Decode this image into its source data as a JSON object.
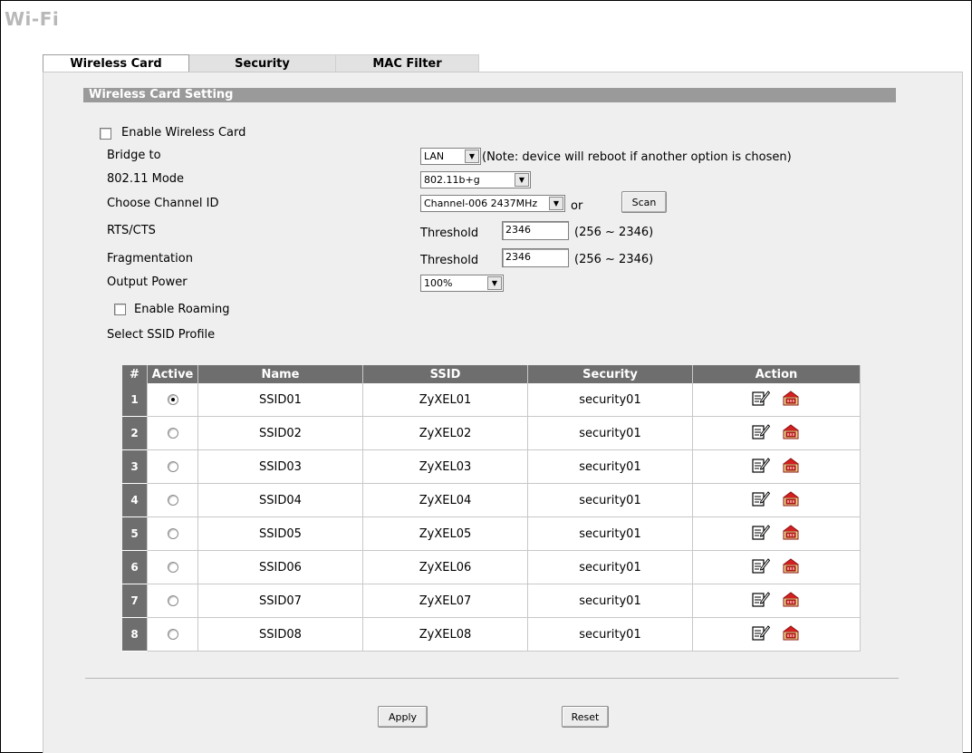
{
  "page": {
    "title": "Wi-Fi"
  },
  "tabs": [
    {
      "label": "Wireless Card",
      "active": true
    },
    {
      "label": "Security",
      "active": false
    },
    {
      "label": "MAC Filter",
      "active": false
    }
  ],
  "section": {
    "title": "Wireless Card Setting"
  },
  "form": {
    "enable_wireless_card": {
      "label": "Enable Wireless Card",
      "checked": false
    },
    "bridge_to": {
      "label": "Bridge to",
      "value": "LAN",
      "note": "(Note: device will reboot if another option is chosen)"
    },
    "mode": {
      "label": "802.11 Mode",
      "value": "802.11b+g"
    },
    "channel": {
      "label": "Choose Channel ID",
      "value": "Channel-006 2437MHz",
      "or": "or",
      "scan_label": "Scan"
    },
    "rts": {
      "label": "RTS/CTS",
      "threshold_label": "Threshold",
      "value": "2346",
      "range": "(256 ~ 2346)"
    },
    "frag": {
      "label": "Fragmentation",
      "threshold_label": "Threshold",
      "value": "2346",
      "range": "(256 ~ 2346)"
    },
    "power": {
      "label": "Output Power",
      "value": "100%"
    },
    "roaming": {
      "label": "Enable Roaming",
      "checked": false
    },
    "ssid_profile_label": "Select SSID Profile"
  },
  "table": {
    "headers": {
      "num": "#",
      "active": "Active",
      "name": "Name",
      "ssid": "SSID",
      "security": "Security",
      "action": "Action"
    },
    "rows": [
      {
        "num": "1",
        "active": true,
        "name": "SSID01",
        "ssid": "ZyXEL01",
        "security": "security01"
      },
      {
        "num": "2",
        "active": false,
        "name": "SSID02",
        "ssid": "ZyXEL02",
        "security": "security01"
      },
      {
        "num": "3",
        "active": false,
        "name": "SSID03",
        "ssid": "ZyXEL03",
        "security": "security01"
      },
      {
        "num": "4",
        "active": false,
        "name": "SSID04",
        "ssid": "ZyXEL04",
        "security": "security01"
      },
      {
        "num": "5",
        "active": false,
        "name": "SSID05",
        "ssid": "ZyXEL05",
        "security": "security01"
      },
      {
        "num": "6",
        "active": false,
        "name": "SSID06",
        "ssid": "ZyXEL06",
        "security": "security01"
      },
      {
        "num": "7",
        "active": false,
        "name": "SSID07",
        "ssid": "ZyXEL07",
        "security": "security01"
      },
      {
        "num": "8",
        "active": false,
        "name": "SSID08",
        "ssid": "ZyXEL08",
        "security": "security01"
      }
    ],
    "icons": {
      "edit": "edit-icon",
      "delete": "delete-icon"
    }
  },
  "buttons": {
    "apply": "Apply",
    "reset": "Reset"
  }
}
